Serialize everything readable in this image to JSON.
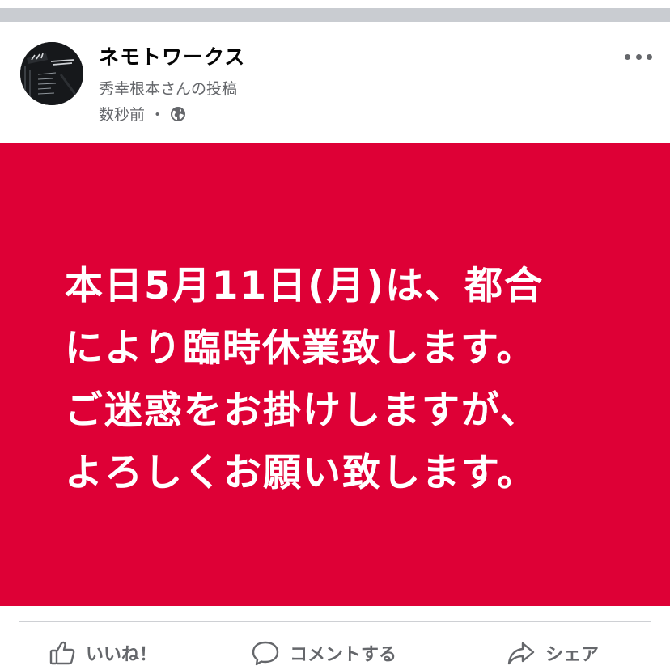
{
  "post": {
    "page_name": "ネモトワークス",
    "posted_by": "秀幸根本さんの投稿",
    "time": "数秒前",
    "separator": "・",
    "privacy_icon": "globe-icon",
    "more_icon": "more-options-icon"
  },
  "banner": {
    "background_color": "#de0036",
    "text_color": "#ffffff",
    "lines": [
      "本日5月11日(月)は、都合",
      "により臨時休業致します。",
      "ご迷惑をお掛けしますが、",
      "よろしくお願い致します。"
    ]
  },
  "actions": {
    "like_label": "いいね！",
    "comment_label": "コメントする",
    "share_label": "シェア",
    "like_icon": "thumbs-up-icon",
    "comment_icon": "comment-bubble-icon",
    "share_icon": "share-arrow-icon"
  }
}
